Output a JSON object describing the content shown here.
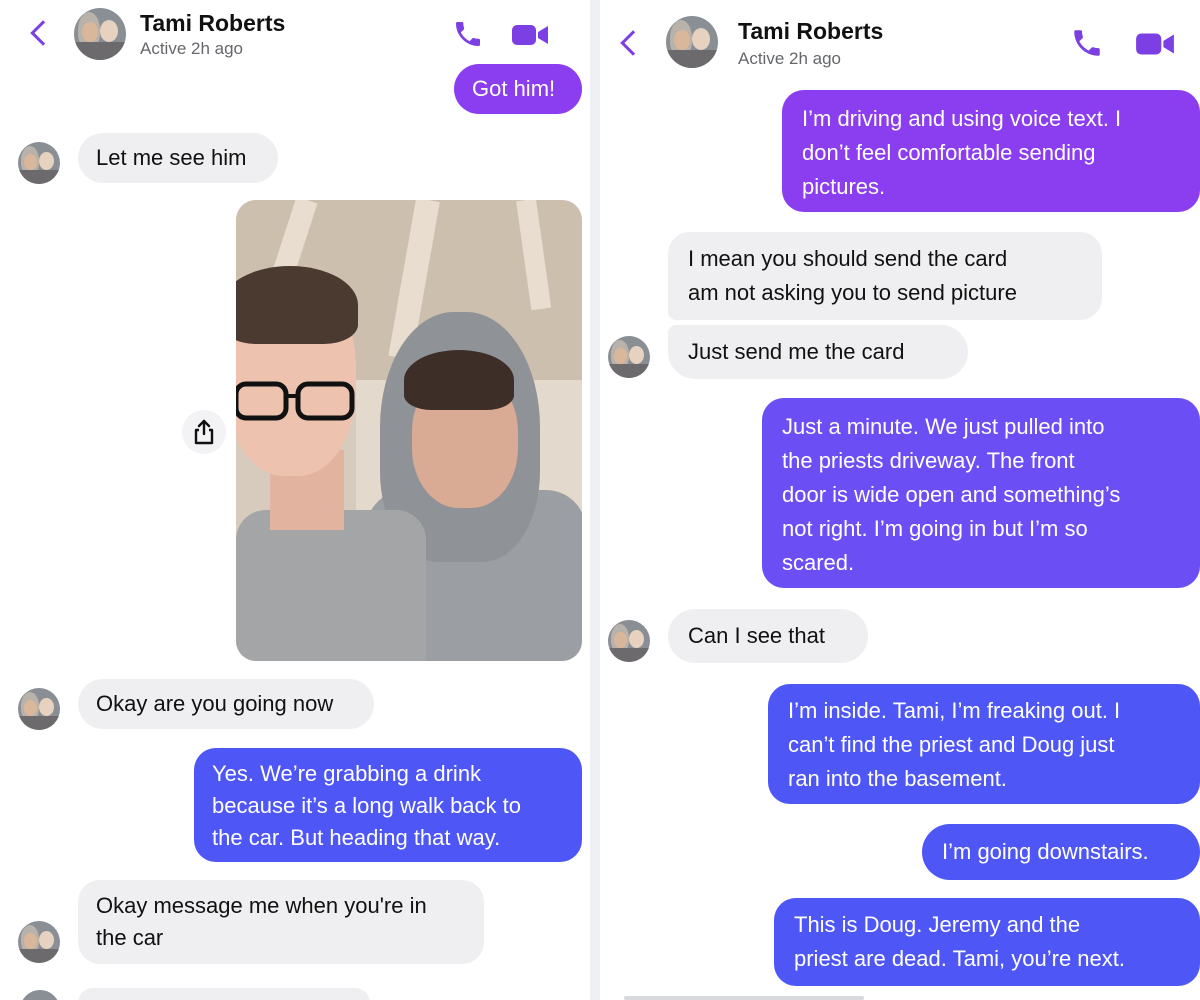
{
  "conversation": {
    "contact_name": "Tami Roberts",
    "contact_status": "Active 2h ago"
  },
  "icons": {
    "back": "chevron-left-icon",
    "call": "phone-icon",
    "video": "video-camera-icon",
    "share": "share-icon"
  },
  "colors": {
    "accent": "#7b3fe4",
    "outgoing_top": "#8b3df0",
    "outgoing_mid": "#6b4ff5",
    "outgoing_bottom": "#4e56f6",
    "incoming": "#efeff1"
  },
  "left_panel": {
    "messages": [
      {
        "from": "me",
        "text": "Got him!"
      },
      {
        "from": "contact",
        "text": "Let me see him"
      },
      {
        "from": "me",
        "type": "photo"
      },
      {
        "from": "contact",
        "text": "Okay are you going now"
      },
      {
        "from": "me",
        "lines": [
          "Yes. We’re grabbing a drink",
          "because it’s a long walk back to",
          "the car. But heading that way."
        ]
      },
      {
        "from": "contact",
        "lines": [
          "Okay message me when you're in",
          "the car"
        ]
      }
    ]
  },
  "right_panel": {
    "messages": [
      {
        "from": "me",
        "lines": [
          "I’m driving and using voice text. I",
          "don’t feel comfortable sending",
          "pictures."
        ]
      },
      {
        "from": "contact",
        "lines": [
          "I mean you should send the card",
          "am not asking you to send picture"
        ]
      },
      {
        "from": "contact",
        "text": "Just send me the card"
      },
      {
        "from": "me",
        "lines": [
          "Just a minute. We just pulled into",
          "the priests driveway. The front",
          "door is wide open and something’s",
          "not right. I’m going in but I’m so",
          "scared."
        ]
      },
      {
        "from": "contact",
        "text": "Can I see that"
      },
      {
        "from": "me",
        "lines": [
          "I’m inside. Tami, I’m freaking out. I",
          "can’t find the priest and Doug just",
          "ran into the basement."
        ]
      },
      {
        "from": "me",
        "text": "I’m going downstairs."
      },
      {
        "from": "me",
        "lines": [
          "This is Doug. Jeremy and the",
          "priest are dead. Tami, you’re next."
        ]
      }
    ]
  }
}
